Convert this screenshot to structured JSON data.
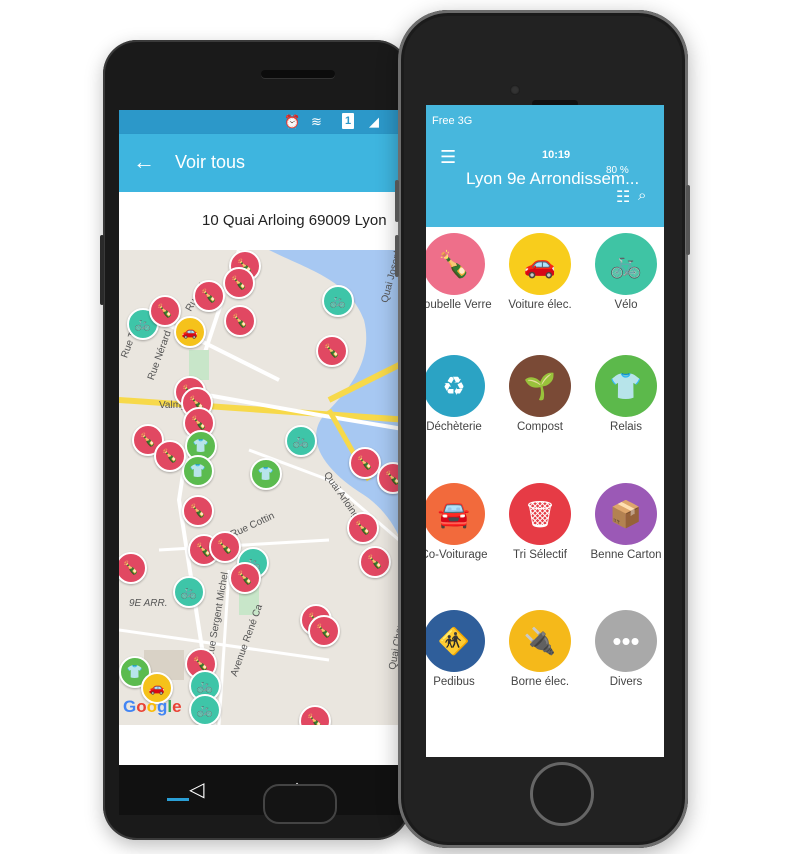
{
  "android": {
    "toolbar": {
      "back_icon": "arrow-left-icon",
      "title": "Voir tous"
    },
    "address": "10 Quai Arloing 69009 Lyon",
    "status_icons": [
      "alarm-icon",
      "wifi-icon",
      "sim-icon",
      "signal-icon"
    ],
    "status_badge": "1",
    "map": {
      "labels": {
        "rue_nerard": "Rue Nérard",
        "valmy": "Valmy",
        "rue_cottin": "Rue Cottin",
        "quai_arloing": "Quai Arloing",
        "arr": "9E ARR.",
        "rue_sergent": "Rue Sergent Michel",
        "avenue_rene": "Avenue René Ca",
        "quai_joseph": "Quai Joseph",
        "quai_chauveau": "Quai Chauveau",
        "rue_tissot": "Rue Tissot",
        "rue_cluzel": "Rue Cl"
      },
      "google": [
        "G",
        "o",
        "o",
        "g",
        "l",
        "e"
      ],
      "google_colors": [
        "#4285F4",
        "#EA4335",
        "#FBBC05",
        "#4285F4",
        "#34A853",
        "#EA4335"
      ]
    },
    "nav_icons": [
      "back-triangle-icon",
      "home-icon",
      "recents-icon"
    ]
  },
  "iphone": {
    "status": {
      "carrier": "Free 3G",
      "time": "10:19",
      "battery": "80 %"
    },
    "toolbar": {
      "title": "Lyon 9e Arrondissem...",
      "menu_icon": "hamburger-icon",
      "list_icon": "list-icon",
      "search_icon": "search-icon"
    },
    "categories": [
      {
        "label": "Poubelle Verre",
        "color": "#ee6f8a",
        "icon": "glass-bin-icon",
        "glyph": "🍾"
      },
      {
        "label": "Voiture élec.",
        "color": "#f8cd1c",
        "icon": "electric-car-icon",
        "glyph": "🚗"
      },
      {
        "label": "Vélo",
        "color": "#3fc4a4",
        "icon": "bicycle-icon",
        "glyph": "🚲"
      },
      {
        "label": "Déchèterie",
        "color": "#2ba3c4",
        "icon": "recycling-icon",
        "glyph": "♻"
      },
      {
        "label": "Compost",
        "color": "#7a4a36",
        "icon": "compost-icon",
        "glyph": "🌱"
      },
      {
        "label": "Relais",
        "color": "#5cb94b",
        "icon": "tshirt-icon",
        "glyph": "👕"
      },
      {
        "label": "Co-Voiturage",
        "color": "#f26a3c",
        "icon": "carpool-icon",
        "glyph": "🚘"
      },
      {
        "label": "Tri Sélectif",
        "color": "#e63b45",
        "icon": "sorting-bins-icon",
        "glyph": "🗑"
      },
      {
        "label": "Benne Carton",
        "color": "#9b59b6",
        "icon": "box-icon",
        "glyph": "📦"
      },
      {
        "label": "Pedibus",
        "color": "#2f5e9a",
        "icon": "pedibus-icon",
        "glyph": "🚸"
      },
      {
        "label": "Borne élec.",
        "color": "#f5b91a",
        "icon": "plug-icon",
        "glyph": "🔌"
      },
      {
        "label": "Divers",
        "color": "#a9a9a9",
        "icon": "more-icon",
        "glyph": "•••"
      }
    ]
  }
}
